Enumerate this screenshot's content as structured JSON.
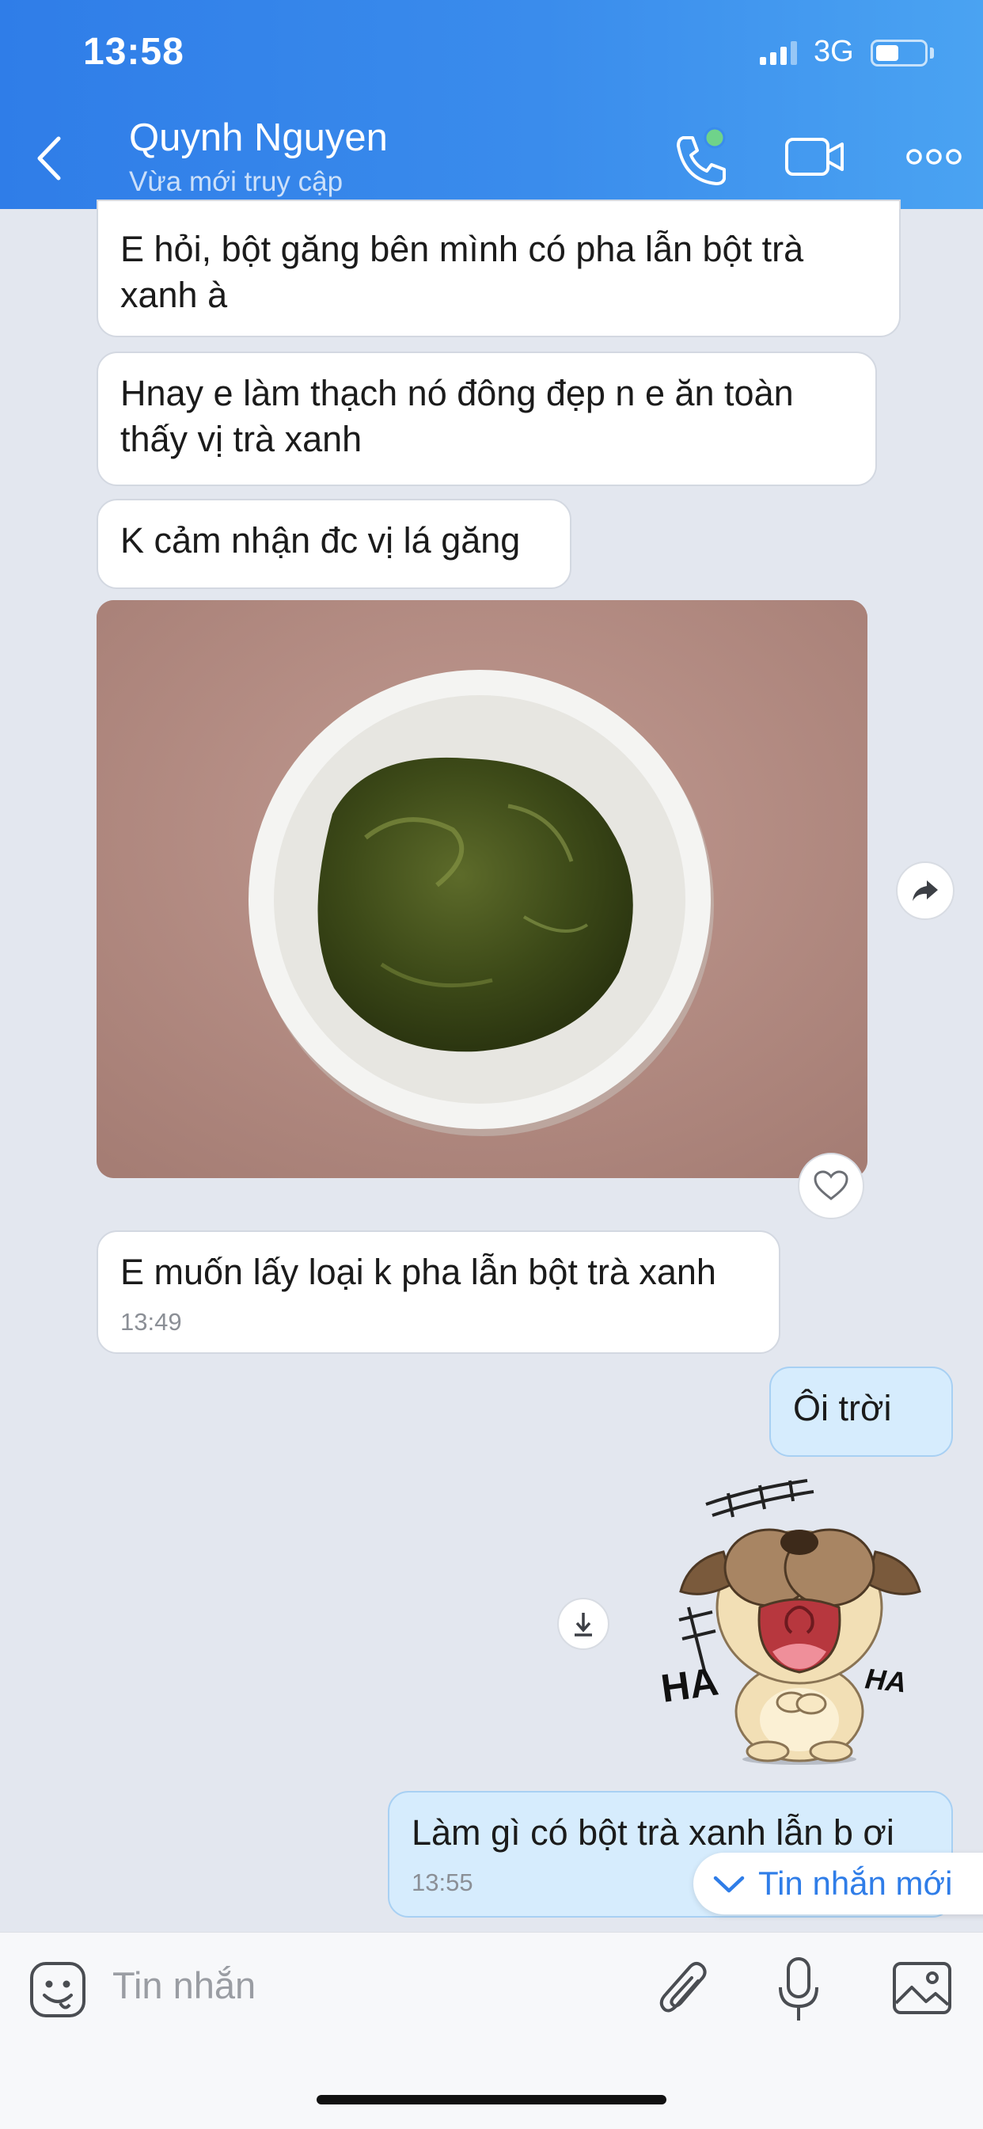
{
  "status_bar": {
    "time": "13:58",
    "network": "3G"
  },
  "header": {
    "contact_name": "Quynh Nguyen",
    "contact_status": "Vừa mới truy cập",
    "icons": [
      "back-chevron-icon",
      "phone-icon",
      "video-camera-icon",
      "more-dots-icon"
    ]
  },
  "messages": [
    {
      "from": "them",
      "text": "E hỏi, bột găng bên mình có pha lẫn bột trà xanh à"
    },
    {
      "from": "them",
      "text": "Hnay e làm thạch nó đông đẹp n e ăn toàn thấy vị trà xanh"
    },
    {
      "from": "them",
      "text": "K cảm nhận đc vị lá găng"
    },
    {
      "from": "them",
      "type": "image",
      "description": "photo of green jelly in a white bowl"
    },
    {
      "from": "them",
      "text": "E muốn lấy loại k pha lẫn bột trà xanh",
      "time": "13:49"
    },
    {
      "from": "me",
      "text": "Ôi trời"
    },
    {
      "from": "me",
      "type": "sticker",
      "sticker_text_left": "HA",
      "sticker_text_right": "HA"
    },
    {
      "from": "me",
      "text": "Làm gì có bột trà xanh lẫn b ơi",
      "time": "13:55"
    }
  ],
  "new_messages_label": "Tin nhắn mới",
  "composer": {
    "placeholder": "Tin nhắn"
  },
  "colors": {
    "header": "#3a8cec",
    "my_bubble": "#d6ecfd",
    "background": "#e3e7ef",
    "accent": "#2f7de8"
  }
}
